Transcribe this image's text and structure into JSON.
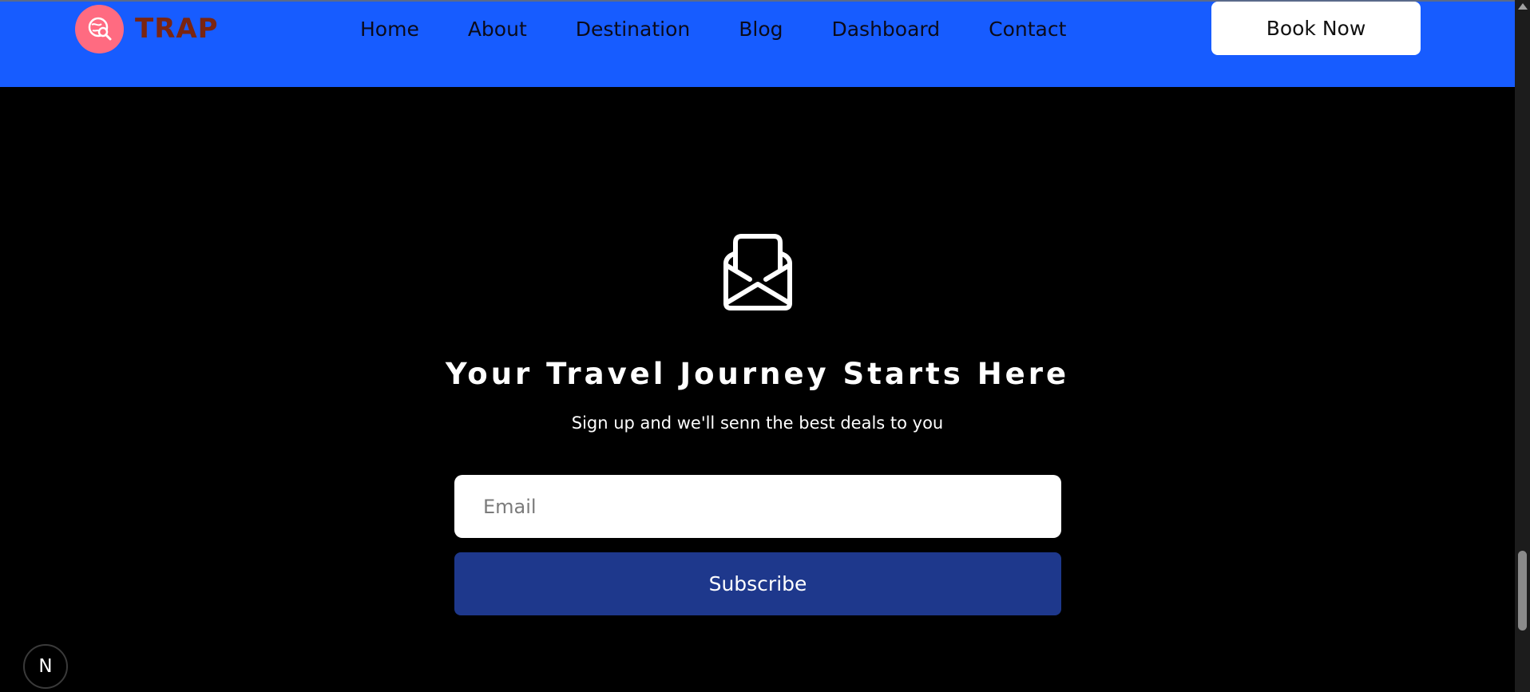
{
  "header": {
    "brand": "TRAP",
    "nav": [
      "Home",
      "About",
      "Destination",
      "Blog",
      "Dashboard",
      "Contact"
    ],
    "cta_label": "Book Now"
  },
  "newsletter": {
    "headline": "Your Travel Journey Starts Here",
    "subtext": "Sign up and we'll senn the best deals to you",
    "email_placeholder": "Email",
    "subscribe_label": "Subscribe"
  },
  "badge": {
    "label": "N"
  },
  "colors": {
    "nav_bg": "#175cff",
    "logo_circle": "#ff6b81",
    "brand_text": "#7a2512",
    "subscribe_bg": "#1e388c",
    "page_bg": "#000000"
  },
  "icons": {
    "logo": "globe-search-icon",
    "newsletter": "open-envelope-icon"
  }
}
